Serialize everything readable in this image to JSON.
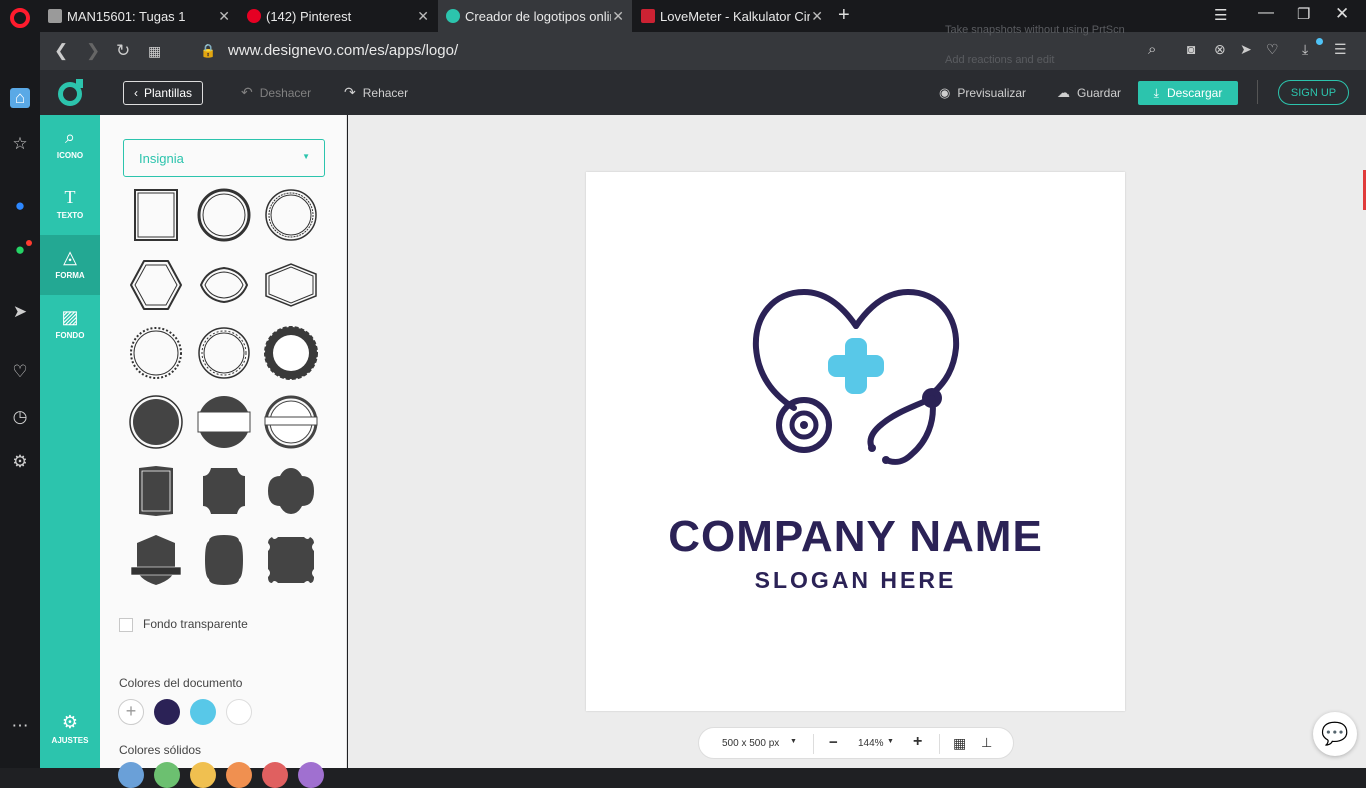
{
  "browser": {
    "tabs": [
      {
        "title": "MAN15601: Tugas 1",
        "favicon_color": "#888888"
      },
      {
        "title": "(142) Pinterest",
        "favicon_color": "#e60023"
      },
      {
        "title": "Creador de logotipos online",
        "favicon_color": "#2cc4ad"
      },
      {
        "title": "LoveMeter - Kalkulator Cinta",
        "favicon_color": "#cc2233"
      }
    ],
    "url": "www.designevo.com/es/apps/logo/",
    "snapshot_hint_1": "Take snapshots without using PrtScn",
    "snapshot_hint_2": "Add reactions and edit"
  },
  "toolbar": {
    "templates_label": "Plantillas",
    "undo_label": "Deshacer",
    "redo_label": "Rehacer",
    "preview_label": "Previsualizar",
    "save_label": "Guardar",
    "download_label": "Descargar",
    "signup_label": "SIGN UP"
  },
  "rail": {
    "icon": "ICONO",
    "text": "TEXTO",
    "shape": "FORMA",
    "background": "FONDO",
    "settings": "AJUSTES"
  },
  "panel": {
    "category": "Insignia",
    "transparent_label": "Fondo transparente",
    "doc_colors_label": "Colores del documento",
    "doc_colors": [
      "#2b2256",
      "#58c8e8",
      "#ffffff"
    ],
    "solid_colors_label": "Colores sólidos",
    "solid_colors": [
      "#6aa0d8",
      "#6cc070",
      "#f0c050",
      "#f09050",
      "#e06060",
      "#a070d0"
    ]
  },
  "logo": {
    "company": "COMPANY NAME",
    "slogan": "SLOGAN HERE",
    "primary_color": "#2b2256",
    "accent_color": "#58c8e8"
  },
  "zoom": {
    "size": "500 x 500 px",
    "level": "144%"
  },
  "colors": {
    "accent": "#2cc4ad"
  }
}
